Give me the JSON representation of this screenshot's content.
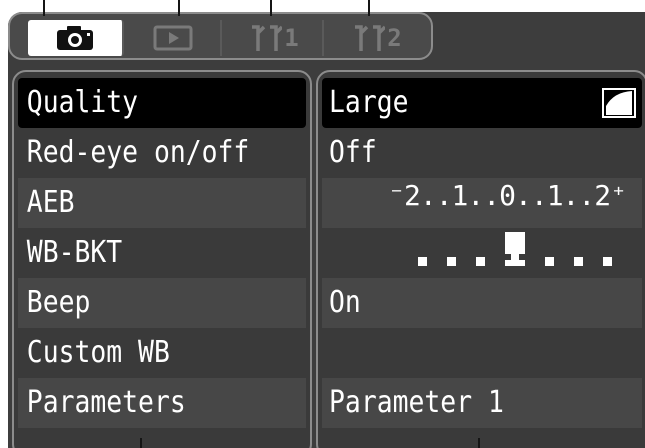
{
  "tabs": [
    {
      "name": "shooting",
      "icon": "camera-icon",
      "label": ""
    },
    {
      "name": "playback",
      "icon": "playback-icon",
      "label": ""
    },
    {
      "name": "setup-1",
      "icon": "setup-icon",
      "label": "1"
    },
    {
      "name": "setup-2",
      "icon": "setup-icon",
      "label": "2"
    }
  ],
  "menu": {
    "items": [
      {
        "label": "Quality",
        "value": "Large"
      },
      {
        "label": "Red-eye on/off",
        "value": "Off"
      },
      {
        "label": "AEB",
        "value": "⁻2..1..̲..1..2⁺"
      },
      {
        "label": "WB-BKT",
        "value": ""
      },
      {
        "label": "Beep",
        "value": "On"
      },
      {
        "label": "Custom WB",
        "value": ""
      },
      {
        "label": "Parameters",
        "value": "Parameter 1"
      }
    ],
    "aeb_scale": "⁻2..1..0..1..2⁺",
    "selected_index": 0
  },
  "colors": {
    "background": "#3d3d3d",
    "selected": "#000000",
    "text": "#ffffff",
    "border": "#8c8c8c"
  }
}
